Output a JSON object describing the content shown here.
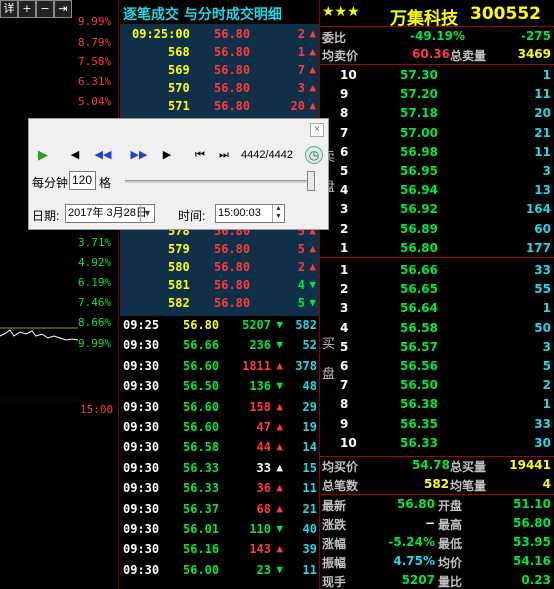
{
  "left": {
    "toolbar": [
      "详",
      "+",
      "−",
      "⇥"
    ],
    "pct_up": [
      "9.99%",
      "8.79%",
      "7.58%",
      "6.31%",
      "5.04%"
    ],
    "pct_down": [
      "3.71%",
      "4.92%",
      "6.19%",
      "7.46%",
      "8.66%",
      "9.99%"
    ],
    "time_label": "15:00"
  },
  "mid": {
    "title": "逐笔成交 与分时成交明细",
    "top_rows": [
      {
        "t": "09:25:00",
        "p": "56.80",
        "v": "2",
        "dir": "up"
      },
      {
        "t": "568",
        "p": "56.80",
        "v": "1",
        "dir": "up"
      },
      {
        "t": "569",
        "p": "56.80",
        "v": "7",
        "dir": "up"
      },
      {
        "t": "570",
        "p": "56.80",
        "v": "3",
        "dir": "up"
      },
      {
        "t": "571",
        "p": "56.80",
        "v": "20",
        "dir": "up"
      }
    ],
    "mid_rows": [
      {
        "t": "578",
        "p": "56.80",
        "v": "5",
        "dir": "up"
      },
      {
        "t": "579",
        "p": "56.80",
        "v": "5",
        "dir": "up"
      },
      {
        "t": "580",
        "p": "56.80",
        "v": "2",
        "dir": "up"
      },
      {
        "t": "581",
        "p": "56.80",
        "v": "4",
        "dir": "down"
      },
      {
        "t": "582",
        "p": "56.80",
        "v": "5",
        "dir": "down"
      }
    ],
    "minute_rows": [
      {
        "t": "09:25",
        "p": "56.80",
        "v": "5207",
        "dir": "down",
        "n": "582",
        "pc": "yellow"
      },
      {
        "t": "09:30",
        "p": "56.66",
        "v": "236",
        "dir": "down",
        "n": "52",
        "pc": "green"
      },
      {
        "t": "09:30",
        "p": "56.60",
        "v": "1811",
        "dir": "up",
        "n": "378",
        "pc": "green"
      },
      {
        "t": "09:30",
        "p": "56.50",
        "v": "136",
        "dir": "down",
        "n": "48",
        "pc": "green"
      },
      {
        "t": "09:30",
        "p": "56.60",
        "v": "158",
        "dir": "up",
        "n": "29",
        "pc": "green"
      },
      {
        "t": "09:30",
        "p": "56.60",
        "v": "47",
        "dir": "up",
        "n": "19",
        "pc": "green"
      },
      {
        "t": "09:30",
        "p": "56.58",
        "v": "44",
        "dir": "up",
        "n": "14",
        "pc": "green"
      },
      {
        "t": "09:30",
        "p": "56.33",
        "v": "33",
        "dir": "up-white",
        "n": "15",
        "pc": "green"
      },
      {
        "t": "09:30",
        "p": "56.33",
        "v": "36",
        "dir": "up",
        "n": "11",
        "pc": "green"
      },
      {
        "t": "09:30",
        "p": "56.37",
        "v": "68",
        "dir": "up",
        "n": "21",
        "pc": "green"
      },
      {
        "t": "09:30",
        "p": "56.01",
        "v": "110",
        "dir": "down",
        "n": "40",
        "pc": "green"
      },
      {
        "t": "09:30",
        "p": "56.16",
        "v": "143",
        "dir": "up",
        "n": "39",
        "pc": "green"
      },
      {
        "t": "09:30",
        "p": "56.00",
        "v": "23",
        "dir": "down",
        "n": "11",
        "pc": "green"
      }
    ]
  },
  "right": {
    "stars": "★★★",
    "stock_name": "万集科技",
    "stock_code": "300552",
    "weibi_label": "委比",
    "weibi_pct": "-49.19%",
    "weibi_val": "-275",
    "avg_sell_label": "均卖价",
    "avg_sell": "60.36",
    "total_sell_label": "总卖量",
    "total_sell": "3469",
    "sell_side_label": "卖盘",
    "buy_side_label": "买盘",
    "sell": [
      {
        "lv": "10",
        "p": "57.30",
        "v": "1"
      },
      {
        "lv": "9",
        "p": "57.20",
        "v": "11"
      },
      {
        "lv": "8",
        "p": "57.18",
        "v": "20"
      },
      {
        "lv": "7",
        "p": "57.00",
        "v": "21"
      },
      {
        "lv": "6",
        "p": "56.98",
        "v": "11"
      },
      {
        "lv": "5",
        "p": "56.95",
        "v": "3"
      },
      {
        "lv": "4",
        "p": "56.94",
        "v": "13"
      },
      {
        "lv": "3",
        "p": "56.92",
        "v": "164"
      },
      {
        "lv": "2",
        "p": "56.89",
        "v": "60"
      },
      {
        "lv": "1",
        "p": "56.80",
        "v": "177"
      }
    ],
    "buy": [
      {
        "lv": "1",
        "p": "56.66",
        "v": "33"
      },
      {
        "lv": "2",
        "p": "56.65",
        "v": "55"
      },
      {
        "lv": "3",
        "p": "56.64",
        "v": "1"
      },
      {
        "lv": "4",
        "p": "56.58",
        "v": "50"
      },
      {
        "lv": "5",
        "p": "56.57",
        "v": "3"
      },
      {
        "lv": "6",
        "p": "56.56",
        "v": "5"
      },
      {
        "lv": "7",
        "p": "56.50",
        "v": "2"
      },
      {
        "lv": "8",
        "p": "56.38",
        "v": "1"
      },
      {
        "lv": "9",
        "p": "56.35",
        "v": "33"
      },
      {
        "lv": "10",
        "p": "56.33",
        "v": "30"
      }
    ],
    "avg_buy_label": "均买价",
    "avg_buy": "54.78",
    "total_buy_label": "总买量",
    "total_buy": "19441",
    "total_trades_label": "总笔数",
    "total_trades": "582",
    "avg_per_trade_label": "均笔量",
    "avg_per_trade": "4",
    "stats": [
      {
        "l1": "最新",
        "v1": "56.80",
        "l2": "开盘",
        "v2": "51.10",
        "c1": "green",
        "c2": "green"
      },
      {
        "l1": "涨跌",
        "v1": "−",
        "l2": "最高",
        "v2": "56.80",
        "c1": "white",
        "c2": "green"
      },
      {
        "l1": "涨幅",
        "v1": "-5.24%",
        "l2": "最低",
        "v2": "53.95",
        "c1": "green",
        "c2": "green"
      },
      {
        "l1": "振幅",
        "v1": "4.75%",
        "l2": "均价",
        "v2": "54.16",
        "c1": "cyan",
        "c2": "green"
      },
      {
        "l1": "现手",
        "v1": "5207",
        "l2": "量比",
        "v2": "0.23",
        "c1": "green",
        "c2": "green"
      }
    ]
  },
  "dialog": {
    "frame_count": "4442/4442",
    "per_minute_label": "每分钟",
    "per_minute_value": "120",
    "per_minute_unit": "格",
    "date_label": "日期:",
    "date_value": "2017年 3月28日",
    "time_label": "时间:",
    "time_value": "15:00:03",
    "speed_pct": 1.0
  }
}
